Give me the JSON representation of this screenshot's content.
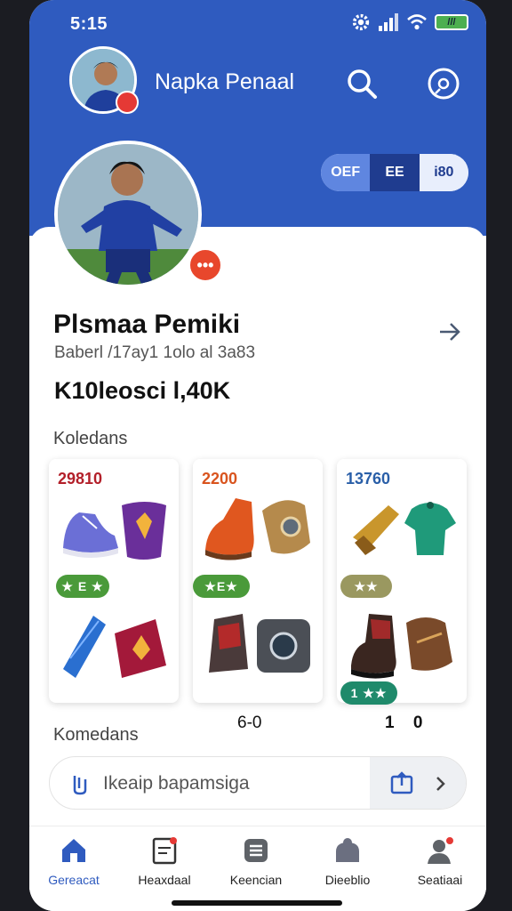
{
  "status": {
    "time": "5:15",
    "battery": "///"
  },
  "header": {
    "title": "Napka Penaal"
  },
  "segments": [
    "OEF",
    "EE",
    "i80"
  ],
  "profile": {
    "name": "Plsmaa Pemiki",
    "subtitle": "Baberl /17ay1 1olo al 3a83",
    "followers": "K10leosci l,40K"
  },
  "collections": {
    "label": "Koledans",
    "items": [
      {
        "price": "29810",
        "price_color": "#b3202a",
        "rating": "★ E ★",
        "rating_color": "#4a9a3a"
      },
      {
        "price": "2200",
        "price_color": "#d9541e",
        "rating": "★E★",
        "rating_color": "#4a9a3a"
      },
      {
        "price": "13760",
        "price_color": "#2a5fa8",
        "rating": "★★",
        "rating_color": "#9a9860",
        "badge": "1 ★★",
        "badge_color": "#1f8a6b"
      }
    ],
    "counts": [
      "6-0",
      "1 0"
    ]
  },
  "comments": {
    "label": "Komedans"
  },
  "search": {
    "placeholder": "Ikeaip bapamsiga"
  },
  "nav": [
    {
      "label": "Gereacat"
    },
    {
      "label": "Heaxdaal"
    },
    {
      "label": "Keencian"
    },
    {
      "label": "Dieeblio"
    },
    {
      "label": "Seatiaai"
    }
  ],
  "colors": {
    "primary": "#2f5bbf",
    "accent_red": "#e53935"
  }
}
